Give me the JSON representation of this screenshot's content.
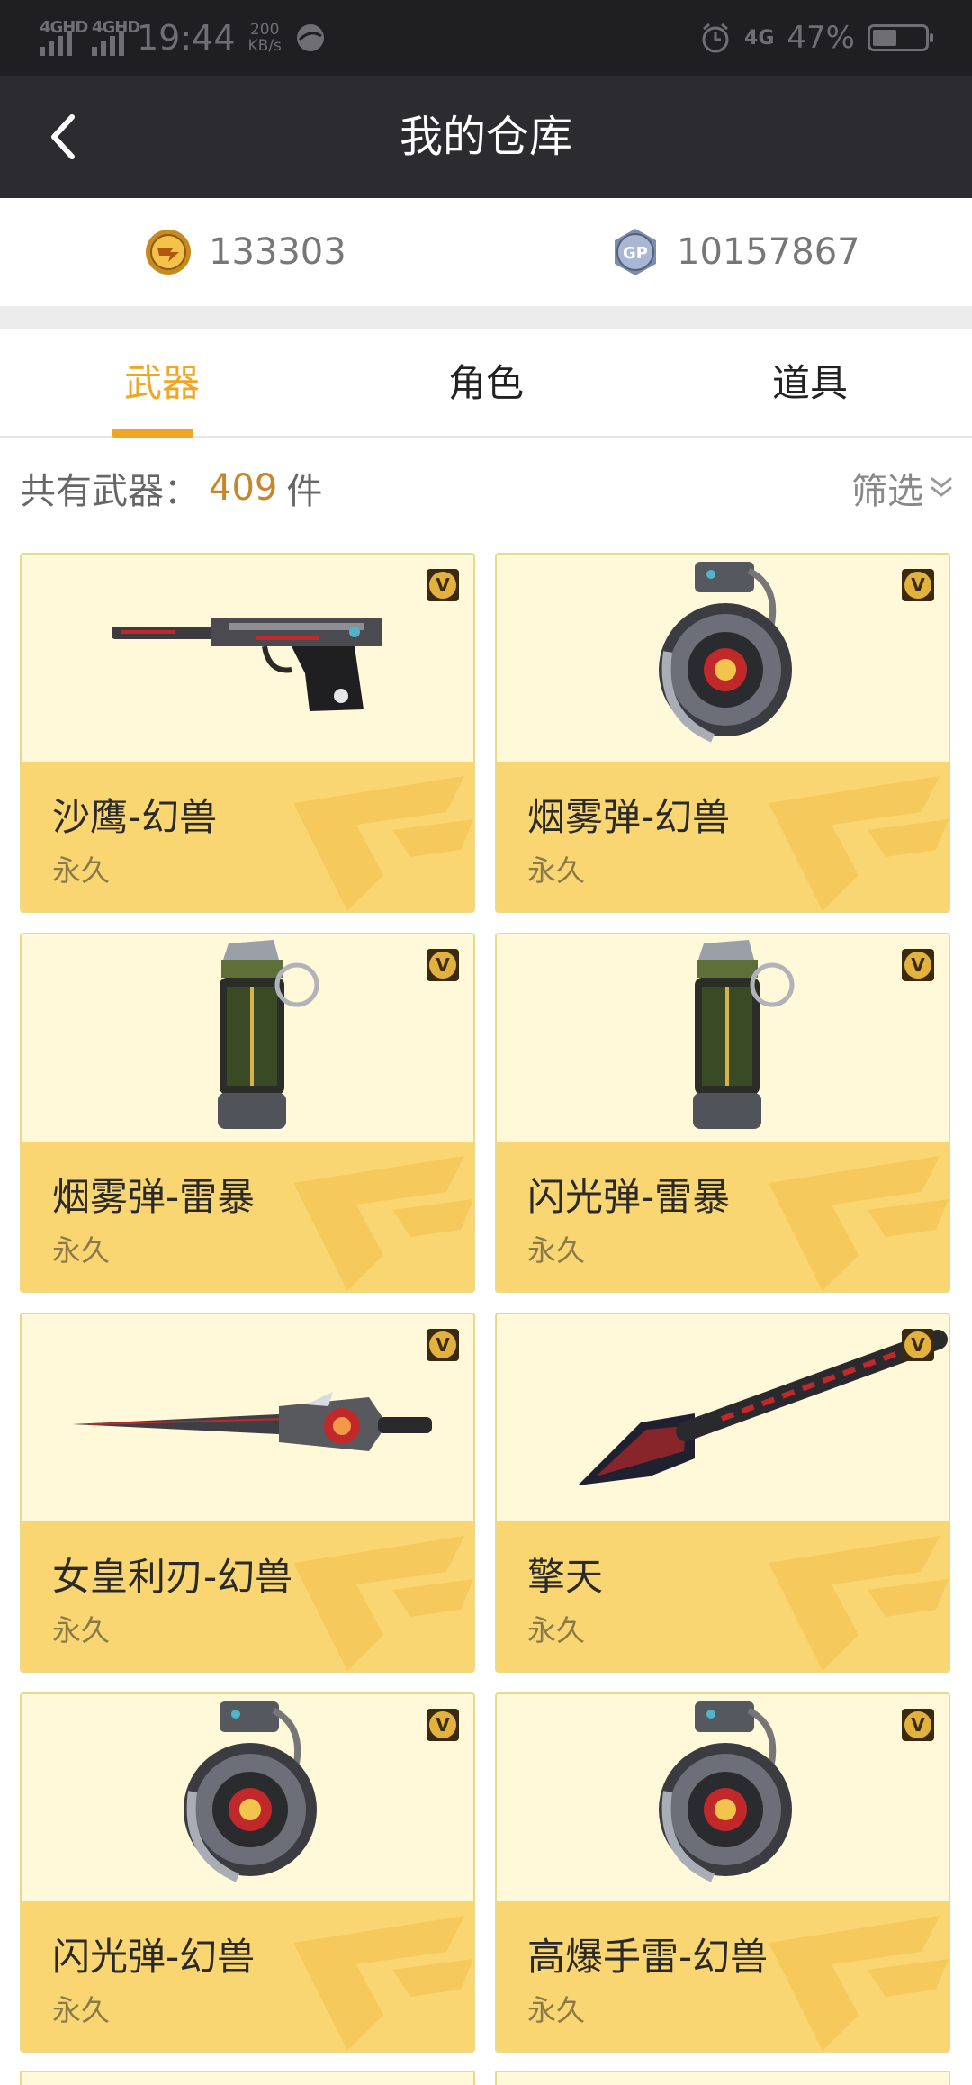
{
  "status_bar": {
    "signal1": "4GHD",
    "signal2": "4GHD",
    "time": "19:44",
    "speed_value": "200",
    "speed_unit": "KB/s",
    "network": "4G",
    "battery_pct": "47%",
    "battery_level": 0.47
  },
  "header": {
    "title": "我的仓库",
    "back_icon": "chevron-left-icon"
  },
  "currency": {
    "cf_points": "133303",
    "cf_icon": "cf-coin-icon",
    "gp_points": "10157867",
    "gp_icon": "gp-coin-icon",
    "gp_badge_text": "GP"
  },
  "tabs": [
    {
      "label": "武器",
      "active": true
    },
    {
      "label": "角色",
      "active": false
    },
    {
      "label": "道具",
      "active": false
    }
  ],
  "summary": {
    "label": "共有武器：",
    "count": "409",
    "unit": "件",
    "filter_label": "筛选",
    "filter_icon": "double-chevron-down-icon"
  },
  "items": [
    {
      "name": "沙鹰-幻兽",
      "duration": "永久",
      "art": "pistol"
    },
    {
      "name": "烟雾弹-幻兽",
      "duration": "永久",
      "art": "grenade-beast"
    },
    {
      "name": "烟雾弹-雷暴",
      "duration": "永久",
      "art": "grenade-storm"
    },
    {
      "name": "闪光弹-雷暴",
      "duration": "永久",
      "art": "grenade-storm"
    },
    {
      "name": "女皇利刃-幻兽",
      "duration": "永久",
      "art": "sword"
    },
    {
      "name": "擎天",
      "duration": "永久",
      "art": "shovel"
    },
    {
      "name": "闪光弹-幻兽",
      "duration": "永久",
      "art": "grenade-beast"
    },
    {
      "name": "高爆手雷-幻兽",
      "duration": "永久",
      "art": "grenade-beast"
    }
  ],
  "vip_badge_text": "V",
  "colors": {
    "accent": "#f0a623",
    "card_bottom": "#f9d672",
    "card_top": "#fff8d9",
    "header": "#2b2b30"
  }
}
